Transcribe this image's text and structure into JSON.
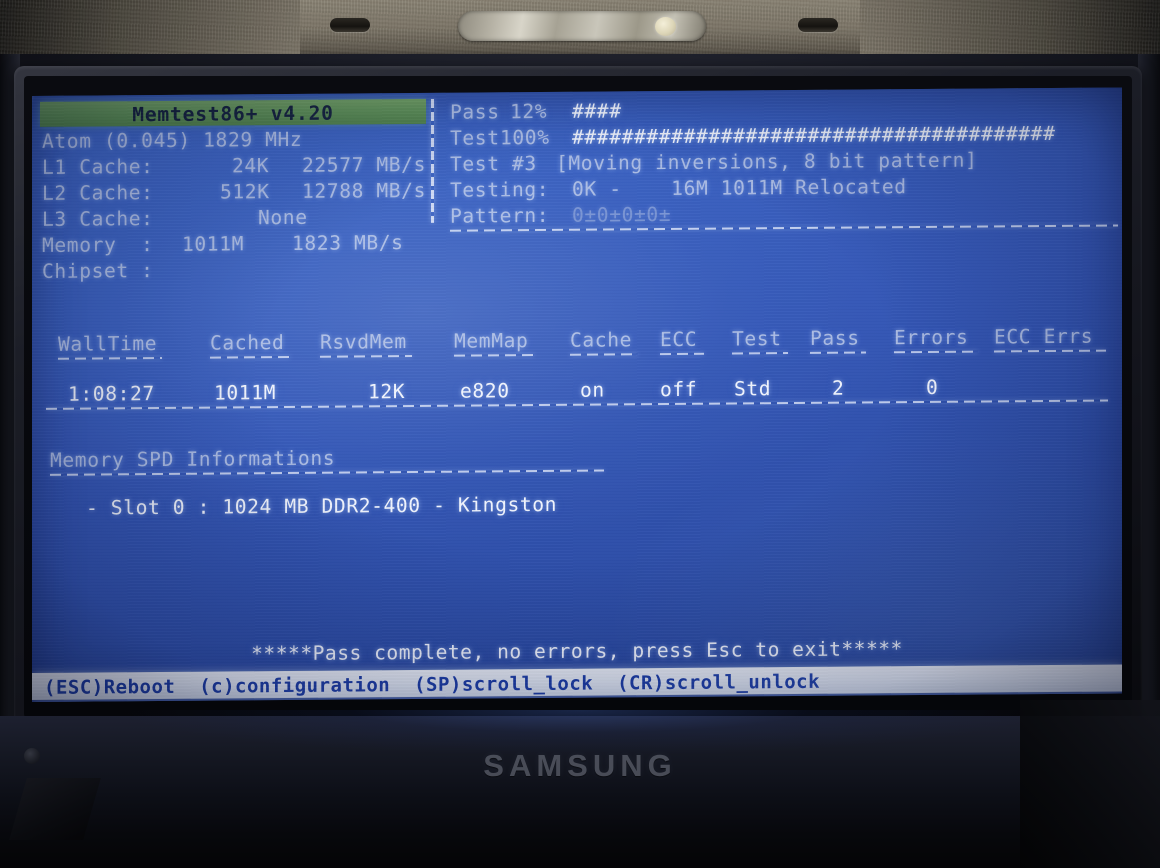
{
  "device": {
    "brand_logo": "SAMSUNG",
    "latch_icon": "laptop-latch-icon",
    "webcam_icon": "webcam-dot-icon"
  },
  "app": {
    "title": "Memtest86+ v4.20"
  },
  "system_info": [
    {
      "label": "Atom (0.045) 1829 MHz",
      "value": "",
      "rate": ""
    },
    {
      "label": "L1 Cache:",
      "value": "24K",
      "rate": "22577 MB/s"
    },
    {
      "label": "L2 Cache:",
      "value": "512K",
      "rate": "12788 MB/s"
    },
    {
      "label": "L3 Cache:",
      "value": "None",
      "rate": ""
    },
    {
      "label": "Memory  :",
      "value": "1011M",
      "rate": "1823 MB/s"
    },
    {
      "label": "Chipset :",
      "value": "",
      "rate": ""
    }
  ],
  "progress": {
    "pass_label": "Pass",
    "pass_percent": "12%",
    "pass_bar": "####",
    "test_label": "Test",
    "test_percent": "100%",
    "test_bar": "#######################################",
    "test_number": "Test #3",
    "test_name": "[Moving inversions, 8 bit pattern]",
    "testing_label": "Testing:",
    "testing_range": "0K -    16M 1011M Relocated",
    "pattern_label": "Pattern:",
    "pattern_value": "0±0±0±0±"
  },
  "status_table": {
    "columns": [
      "WallTime",
      "Cached",
      "RsvdMem",
      "MemMap",
      "Cache",
      "ECC",
      "Test",
      "Pass",
      "Errors",
      "ECC Errs"
    ],
    "underlines": [
      "--------",
      "------",
      "-------",
      "------",
      "-----",
      "---",
      "----",
      "----",
      "------",
      "--------"
    ],
    "row": [
      "1:08:27",
      "1011M",
      "12K",
      "e820",
      "on",
      "off",
      "Std",
      "2",
      "0",
      ""
    ]
  },
  "spd": {
    "heading": "Memory SPD Informations",
    "slots": [
      "- Slot 0 : 1024 MB DDR2-400 - Kingston"
    ]
  },
  "footer": {
    "pass_message": "*****Pass complete, no errors, press Esc to exit*****",
    "keys": "(ESC)Reboot  (c)configuration  (SP)scroll_lock  (CR)scroll_unlock"
  },
  "colors": {
    "screen_blue": "#3558b8",
    "title_green": "#5e9056",
    "text_white": "#e6ecfb",
    "helpbar_bg": "#dfe6f4",
    "helpbar_text": "#1c3da8"
  }
}
